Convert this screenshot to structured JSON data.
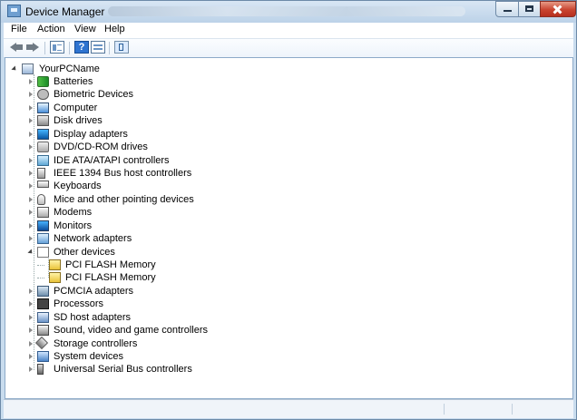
{
  "window": {
    "title": "Device Manager"
  },
  "menu": {
    "file": "File",
    "action": "Action",
    "view": "View",
    "help": "Help"
  },
  "toolbar": {
    "back_icon": "back-arrow-icon",
    "forward_icon": "forward-arrow-icon",
    "properties_icon": "properties-icon",
    "help_icon": "help-icon",
    "view_icon": "view-icon",
    "scan_icon": "scan-hardware-icon",
    "help_glyph": "?"
  },
  "tree": {
    "root": "YourPCName",
    "items": [
      {
        "label": "Batteries",
        "icon": "battery-icon"
      },
      {
        "label": "Biometric Devices",
        "icon": "biometric-icon"
      },
      {
        "label": "Computer",
        "icon": "computer-icon"
      },
      {
        "label": "Disk drives",
        "icon": "disk-drive-icon"
      },
      {
        "label": "Display adapters",
        "icon": "display-adapter-icon"
      },
      {
        "label": "DVD/CD-ROM drives",
        "icon": "dvd-drive-icon"
      },
      {
        "label": "IDE ATA/ATAPI controllers",
        "icon": "ide-controller-icon"
      },
      {
        "label": "IEEE 1394 Bus host controllers",
        "icon": "firewire-controller-icon"
      },
      {
        "label": "Keyboards",
        "icon": "keyboard-icon"
      },
      {
        "label": "Mice and other pointing devices",
        "icon": "mouse-icon"
      },
      {
        "label": "Modems",
        "icon": "modem-icon"
      },
      {
        "label": "Monitors",
        "icon": "monitor-icon"
      },
      {
        "label": "Network adapters",
        "icon": "network-adapter-icon"
      },
      {
        "label": "Other devices",
        "icon": "unknown-device-icon"
      },
      {
        "label": "PCI FLASH Memory",
        "icon": "warning-device-icon"
      },
      {
        "label": "PCI FLASH Memory",
        "icon": "warning-device-icon"
      },
      {
        "label": "PCMCIA adapters",
        "icon": "pcmcia-icon"
      },
      {
        "label": "Processors",
        "icon": "processor-icon"
      },
      {
        "label": "SD host adapters",
        "icon": "sd-card-icon"
      },
      {
        "label": "Sound, video and game controllers",
        "icon": "sound-icon"
      },
      {
        "label": "Storage controllers",
        "icon": "storage-controller-icon"
      },
      {
        "label": "System devices",
        "icon": "system-device-icon"
      },
      {
        "label": "Universal Serial Bus controllers",
        "icon": "usb-icon"
      }
    ]
  }
}
